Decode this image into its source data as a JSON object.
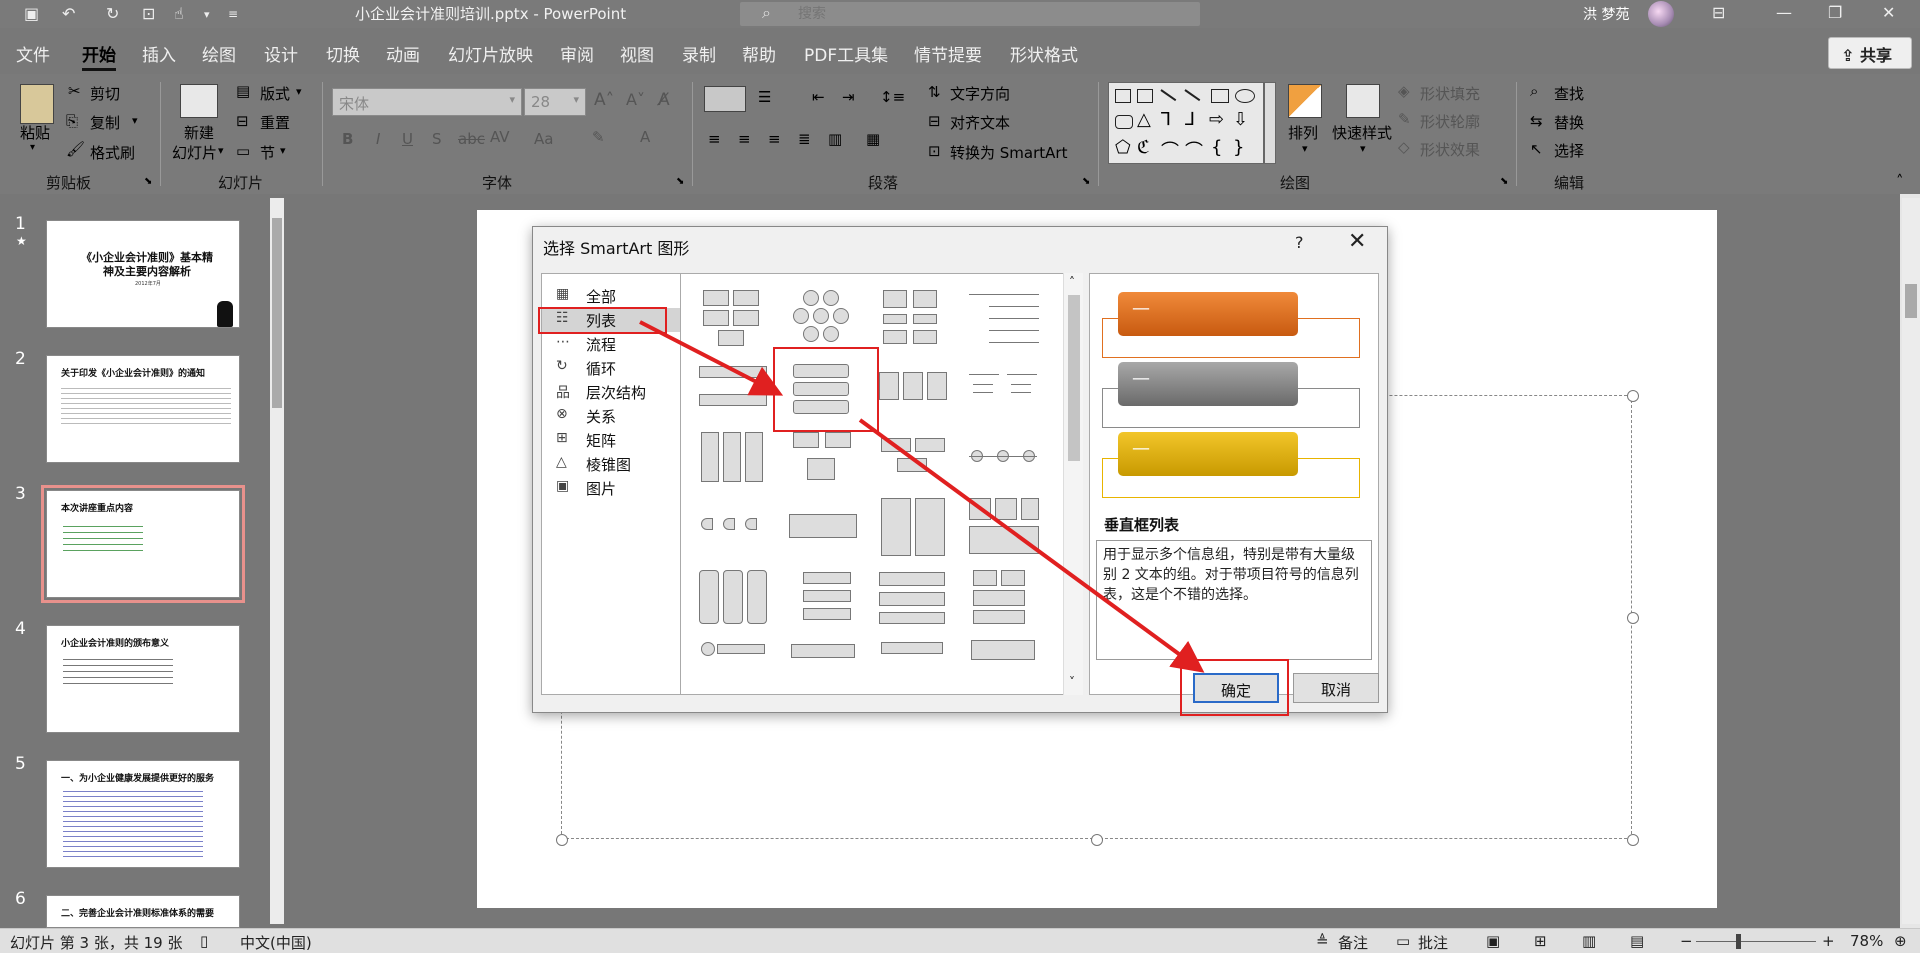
{
  "titlebar": {
    "doc_title": "小企业会计准则培训.pptx  -  PowerPoint",
    "search_placeholder": "搜索",
    "user_name": "洪 梦苑"
  },
  "menu": {
    "tabs": [
      "文件",
      "开始",
      "插入",
      "绘图",
      "设计",
      "切换",
      "动画",
      "幻灯片放映",
      "审阅",
      "视图",
      "录制",
      "帮助",
      "PDF工具集",
      "情节提要",
      "形状格式"
    ],
    "active_tab": "开始",
    "share": "共享"
  },
  "ribbon": {
    "clipboard": {
      "paste": "粘贴",
      "cut": "剪切",
      "copy": "复制",
      "format_painter": "格式刷",
      "label": "剪贴板"
    },
    "slides": {
      "new_slide_1": "新建",
      "new_slide_2": "幻灯片",
      "layout": "版式",
      "reset": "重置",
      "section": "节",
      "label": "幻灯片"
    },
    "font": {
      "font_name": "宋体",
      "font_size": "28",
      "label": "字体"
    },
    "paragraph": {
      "text_direction": "文字方向",
      "align_text": "对齐文本",
      "convert_smartart": "转换为 SmartArt",
      "label": "段落"
    },
    "drawing": {
      "arrange": "排列",
      "quick_styles": "快速样式",
      "shape_fill": "形状填充",
      "shape_outline": "形状轮廓",
      "shape_effects": "形状效果",
      "label": "绘图"
    },
    "editing": {
      "find": "查找",
      "replace": "替换",
      "select": "选择",
      "label": "编辑"
    }
  },
  "thumbnails": [
    {
      "num": "1",
      "star": "★",
      "title": "《小企业会计准则》基本精神及主要内容解析",
      "sub": "2012年7月"
    },
    {
      "num": "2",
      "title": "关于印发《小企业会计准则》的通知"
    },
    {
      "num": "3",
      "title": "本次讲座重点内容"
    },
    {
      "num": "4",
      "title": "小企业会计准则的颁布意义"
    },
    {
      "num": "5",
      "title": "一、为小企业健康发展提供更好的服务"
    },
    {
      "num": "6",
      "title": "二、完善企业会计准则标准体系的需要"
    }
  ],
  "dialog": {
    "title": "选择 SmartArt 图形",
    "help": "?",
    "close": "✕",
    "categories": [
      {
        "icon": "▦",
        "label": "全部"
      },
      {
        "icon": "☷",
        "label": "列表"
      },
      {
        "icon": "⋯",
        "label": "流程"
      },
      {
        "icon": "↻",
        "label": "循环"
      },
      {
        "icon": "品",
        "label": "层次结构"
      },
      {
        "icon": "⊗",
        "label": "关系"
      },
      {
        "icon": "⊞",
        "label": "矩阵"
      },
      {
        "icon": "△",
        "label": "棱锥图"
      },
      {
        "icon": "▣",
        "label": "图片"
      }
    ],
    "selected_category": "列表",
    "preview_name": "垂直框列表",
    "preview_desc": "用于显示多个信息组，特别是带有大量级别 2 文本的组。对于带项目符号的信息列表，这是个不错的选择。",
    "preview_dash": "—",
    "ok": "确定",
    "cancel": "取消"
  },
  "status": {
    "slide_info": "幻灯片 第 3 张，共 19 张",
    "language": "中文(中国)",
    "notes": "备注",
    "comments": "批注",
    "zoom": "78%"
  },
  "colors": {
    "annotation_red": "#e02020",
    "preview_orange": "#e07020",
    "preview_gray": "#8a8a8a",
    "preview_gold": "#e8b400",
    "thumb_selected": "#e8918c"
  }
}
